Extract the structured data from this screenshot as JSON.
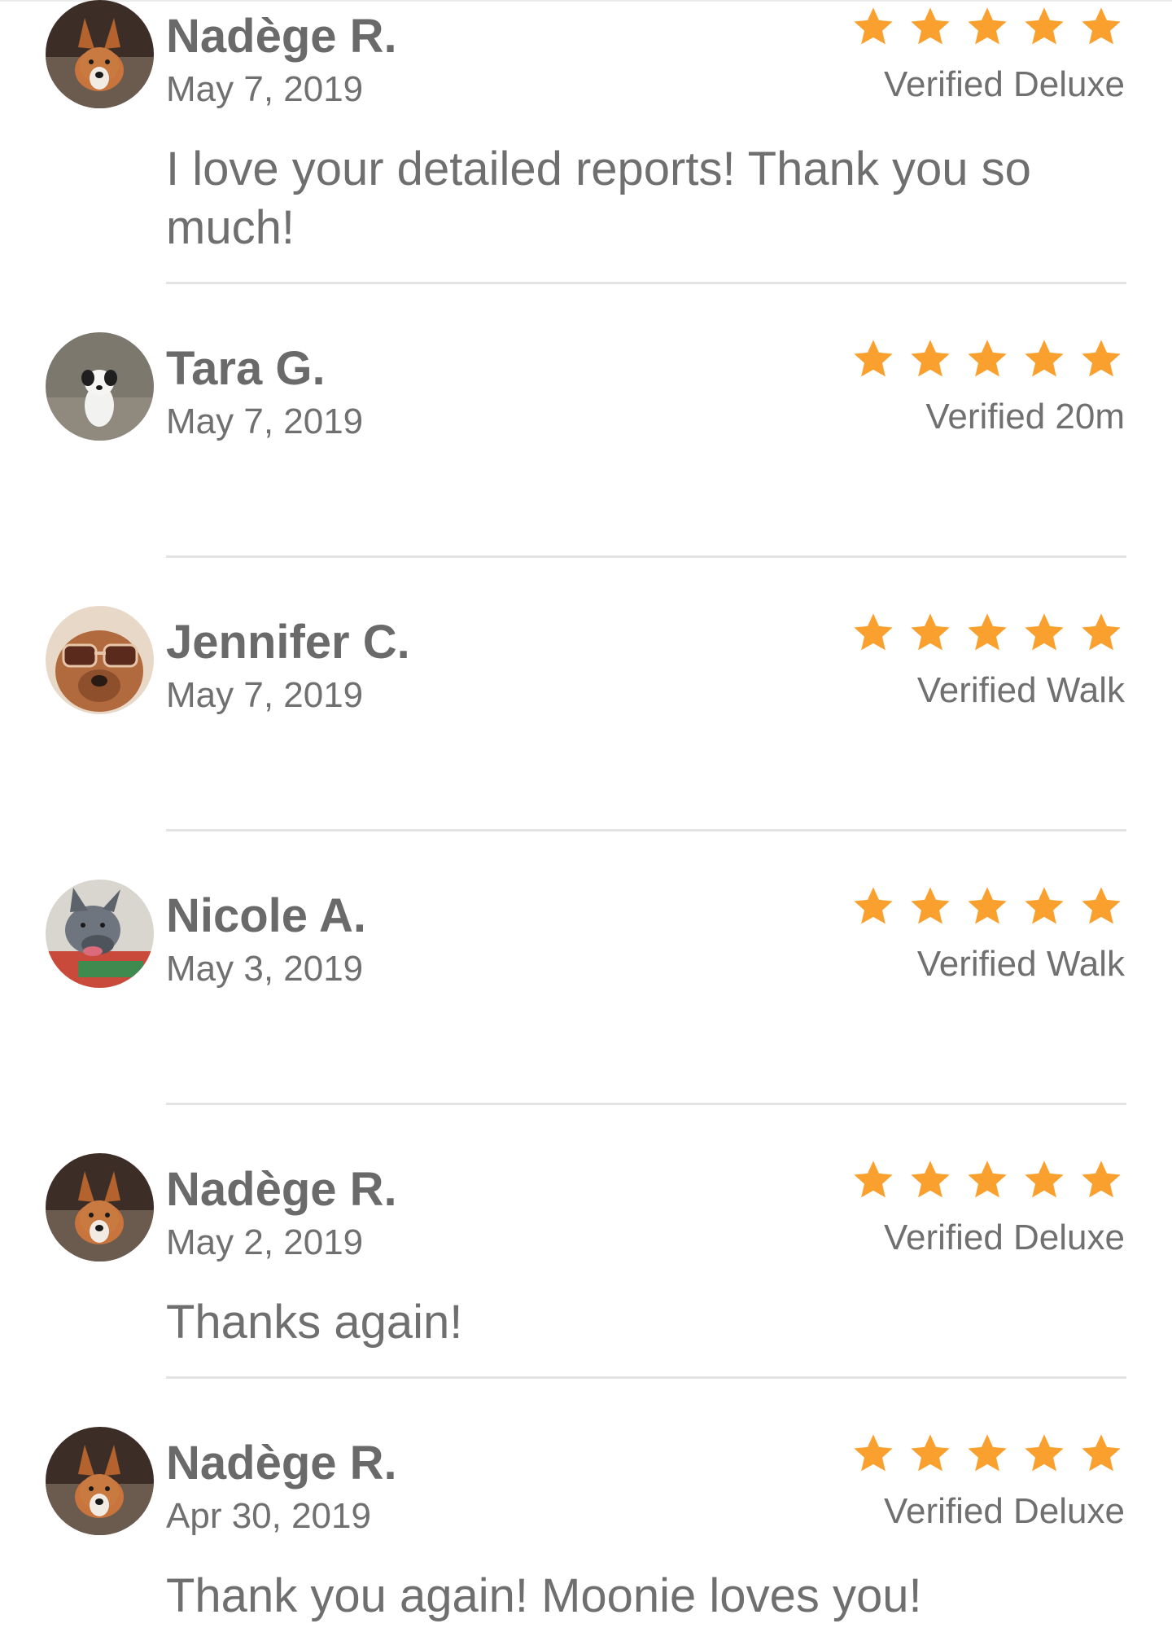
{
  "accent_color": "#F9A02E",
  "reviews": [
    {
      "name": "Nadège R.",
      "date": "May 7, 2019",
      "rating": 5,
      "verified": "Verified Deluxe",
      "comment": "I love your detailed reports! Thank you so much!",
      "avatar_icon": "corgi-avatar"
    },
    {
      "name": "Tara G.",
      "date": "May 7, 2019",
      "rating": 5,
      "verified": "Verified 20m",
      "comment": "",
      "avatar_icon": "small-dog-avatar"
    },
    {
      "name": "Jennifer C.",
      "date": "May 7, 2019",
      "rating": 5,
      "verified": "Verified Walk",
      "comment": "",
      "avatar_icon": "dog-sunglasses-avatar"
    },
    {
      "name": "Nicole A.",
      "date": "May 3, 2019",
      "rating": 5,
      "verified": "Verified Walk",
      "comment": "",
      "avatar_icon": "gray-dog-avatar"
    },
    {
      "name": "Nadège R.",
      "date": "May 2, 2019",
      "rating": 5,
      "verified": "Verified Deluxe",
      "comment": "Thanks again!",
      "avatar_icon": "corgi-avatar"
    },
    {
      "name": "Nadège R.",
      "date": "Apr 30, 2019",
      "rating": 5,
      "verified": "Verified Deluxe",
      "comment": "Thank you again! Moonie loves you!",
      "avatar_icon": "corgi-avatar"
    }
  ]
}
